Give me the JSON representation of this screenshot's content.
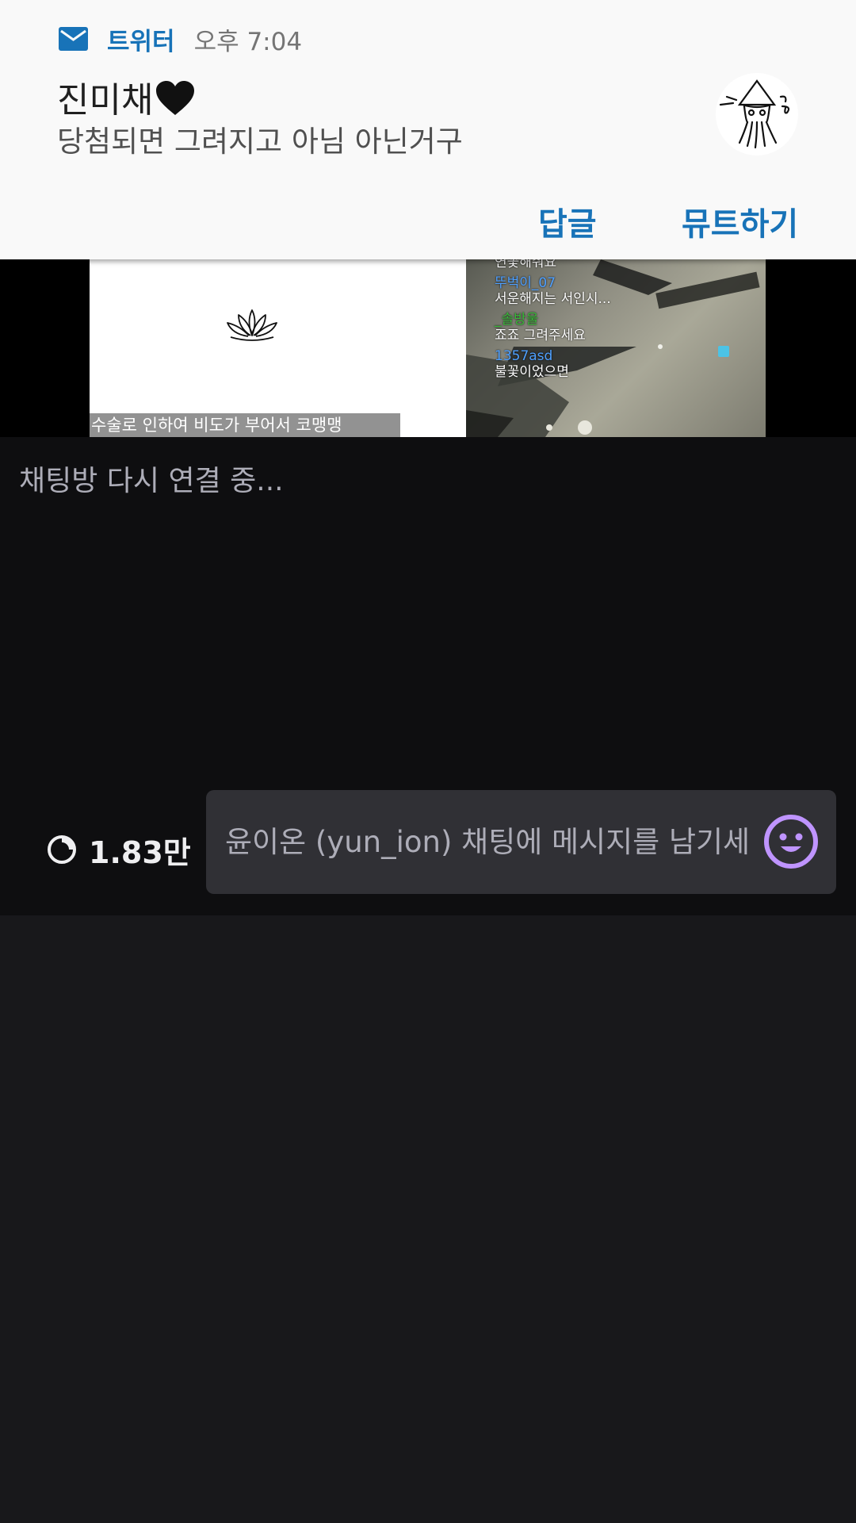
{
  "notification": {
    "app_name": "트위터",
    "time": "오후 7:04",
    "title": "진미채",
    "body": "당첨되면 그려지고 아님 아닌거구",
    "actions": {
      "reply": "답글",
      "mute": "뮤트하기"
    },
    "accent_color": "#1873b8"
  },
  "stream": {
    "caption": "수술로 인하여 비도가 부어서 코맹맹",
    "overlay_chat": [
      {
        "user": "",
        "message": "연꽃해줘요"
      },
      {
        "user": "뚜벅이_07",
        "message": "서운해지는 서인시..."
      },
      {
        "user": "_솔방울",
        "message": "죠죠 그려주세요"
      },
      {
        "user": "1357asd",
        "message": "불꽃이었으면"
      }
    ]
  },
  "chat": {
    "status": "채팅방 다시 연결 중...",
    "viewer_count": "1.83만",
    "input_placeholder": "윤이온 (yun_ion) 채팅에 메시지를 남기세",
    "emote_color": "#bf94ff"
  }
}
